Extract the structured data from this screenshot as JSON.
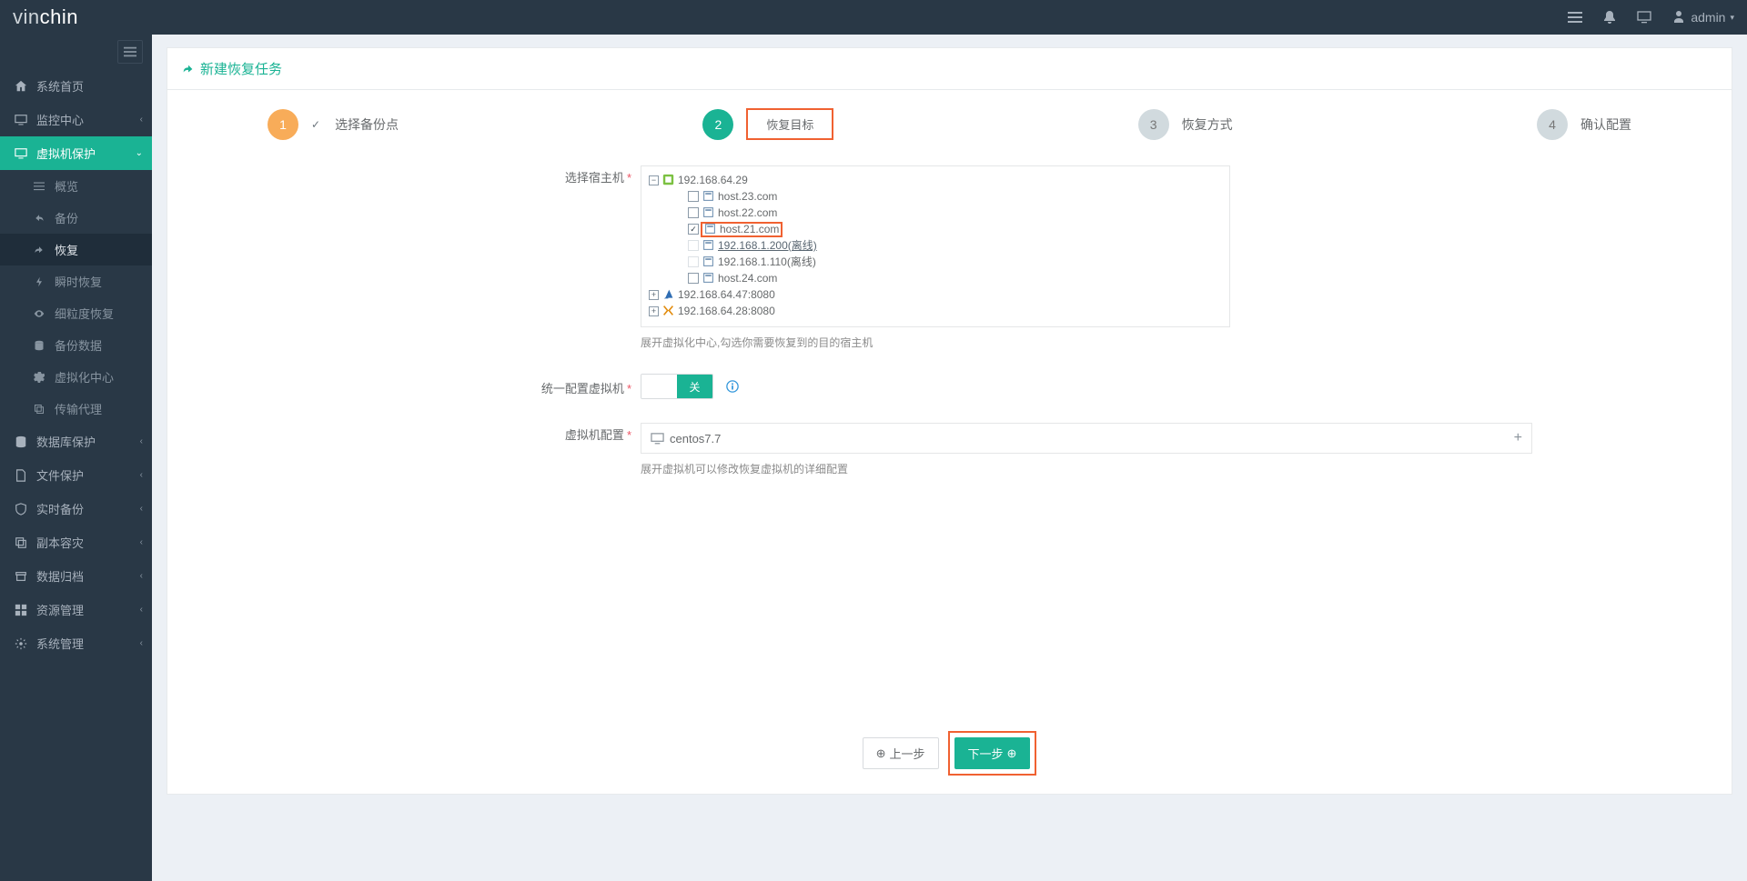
{
  "brand": "vinchin",
  "user": {
    "name": "admin"
  },
  "sidebar": {
    "items": [
      {
        "label": "系统首页"
      },
      {
        "label": "监控中心"
      },
      {
        "label": "虚拟机保护"
      },
      {
        "label": "数据库保护"
      },
      {
        "label": "文件保护"
      },
      {
        "label": "实时备份"
      },
      {
        "label": "副本容灾"
      },
      {
        "label": "数据归档"
      },
      {
        "label": "资源管理"
      },
      {
        "label": "系统管理"
      }
    ],
    "sub_vm": [
      {
        "label": "概览"
      },
      {
        "label": "备份"
      },
      {
        "label": "恢复"
      },
      {
        "label": "瞬时恢复"
      },
      {
        "label": "细粒度恢复"
      },
      {
        "label": "备份数据"
      },
      {
        "label": "虚拟化中心"
      },
      {
        "label": "传输代理"
      }
    ]
  },
  "page_title": "新建恢复任务",
  "steps": [
    {
      "num": "1",
      "label": "选择备份点"
    },
    {
      "num": "2",
      "label": "恢复目标"
    },
    {
      "num": "3",
      "label": "恢复方式"
    },
    {
      "num": "4",
      "label": "确认配置"
    }
  ],
  "form": {
    "select_host_label": "选择宿主机",
    "select_host_hint": "展开虚拟化中心,勾选你需要恢复到的目的宿主机",
    "unified_cfg_label": "统一配置虚拟机",
    "toggle_off": "关",
    "vm_cfg_label": "虚拟机配置",
    "vm_cfg_hint": "展开虚拟机可以修改恢复虚拟机的详细配置",
    "vm_name": "centos7.7"
  },
  "tree": {
    "root1": "192.168.64.29",
    "hosts": [
      "host.23.com",
      "host.22.com",
      "host.21.com",
      "192.168.1.200(离线)",
      "192.168.1.110(离线)",
      "host.24.com"
    ],
    "root2": "192.168.64.47:8080",
    "root3": "192.168.64.28:8080"
  },
  "buttons": {
    "prev": "上一步",
    "next": "下一步"
  }
}
